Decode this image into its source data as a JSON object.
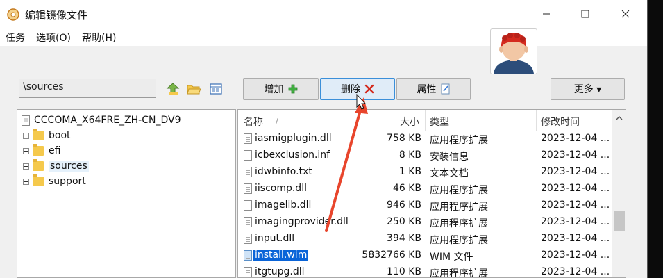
{
  "window": {
    "title": "编辑镜像文件"
  },
  "menu": {
    "task": "任务",
    "options": "选项(O)",
    "help": "帮助(H)"
  },
  "toolbar": {
    "path": "\\sources",
    "add_label": "增加",
    "delete_label": "删除",
    "properties_label": "属性",
    "more_label": "更多 ▾"
  },
  "tree": {
    "root": "CCCOMA_X64FRE_ZH-CN_DV9",
    "items": [
      {
        "label": "boot"
      },
      {
        "label": "efi"
      },
      {
        "label": "sources"
      },
      {
        "label": "support"
      }
    ]
  },
  "list": {
    "columns": {
      "name": "名称",
      "size": "大小",
      "type": "类型",
      "date": "修改时间"
    },
    "sort_indicator": "/",
    "rows": [
      {
        "name": "iasmigplugin.dll",
        "size": "758 KB",
        "type": "应用程序扩展",
        "date": "2023-12-04 ..."
      },
      {
        "name": "icbexclusion.inf",
        "size": "8 KB",
        "type": "安装信息",
        "date": "2023-12-04 ..."
      },
      {
        "name": "idwbinfo.txt",
        "size": "1 KB",
        "type": "文本文档",
        "date": "2023-12-04 ..."
      },
      {
        "name": "iiscomp.dll",
        "size": "46 KB",
        "type": "应用程序扩展",
        "date": "2023-12-04 ..."
      },
      {
        "name": "imagelib.dll",
        "size": "946 KB",
        "type": "应用程序扩展",
        "date": "2023-12-04 ..."
      },
      {
        "name": "imagingprovider.dll",
        "size": "250 KB",
        "type": "应用程序扩展",
        "date": "2023-12-04 ..."
      },
      {
        "name": "input.dll",
        "size": "394 KB",
        "type": "应用程序扩展",
        "date": "2023-12-04 ..."
      },
      {
        "name": "install.wim",
        "size": "5832766 KB",
        "type": "WIM 文件",
        "date": "2023-12-04 ..."
      },
      {
        "name": "itgtupg.dll",
        "size": "110 KB",
        "type": "应用程序扩展",
        "date": "2023-12-04 ..."
      }
    ]
  },
  "colors": {
    "selection": "#0a64d8",
    "annotation_arrow": "#e8452c",
    "folder": "#f5c94c"
  }
}
